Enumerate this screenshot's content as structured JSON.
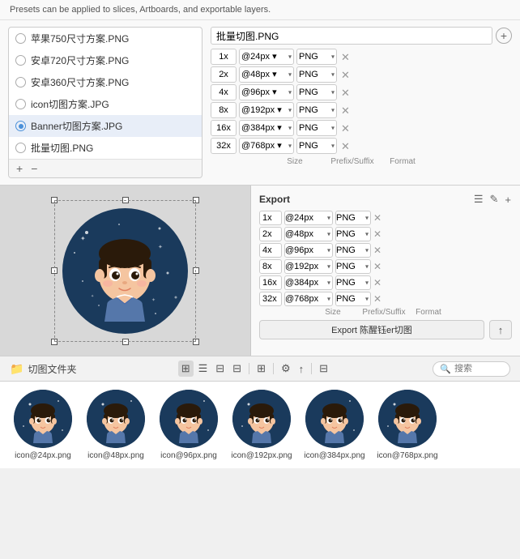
{
  "hint": "Presets can be applied to slices, Artboards, and exportable layers.",
  "presets": {
    "items": [
      {
        "label": "苹果750尺寸方案.PNG",
        "checked": false
      },
      {
        "label": "安卓720尺寸方案.PNG",
        "checked": false
      },
      {
        "label": "安卓360尺寸方案.PNG",
        "checked": false
      },
      {
        "label": "icon切图方案.JPG",
        "checked": false
      },
      {
        "label": "Banner切图方案.JPG",
        "checked": true
      },
      {
        "label": "批量切图.PNG",
        "checked": false
      }
    ],
    "add_btn": "+",
    "remove_btn": "−"
  },
  "export_preset": {
    "name": "批量切图.PNG",
    "rows": [
      {
        "scale": "1x",
        "size": "@24px",
        "format": "PNG"
      },
      {
        "scale": "2x",
        "size": "@48px",
        "format": "PNG"
      },
      {
        "scale": "4x",
        "size": "@96px",
        "format": "PNG"
      },
      {
        "scale": "8x",
        "size": "@192px",
        "format": "PNG"
      },
      {
        "scale": "16x",
        "size": "@384px",
        "format": "PNG"
      },
      {
        "scale": "32x",
        "size": "@768px",
        "format": "PNG"
      }
    ],
    "col_size": "Size",
    "col_prefix": "Prefix/Suffix",
    "col_format": "Format"
  },
  "export_right": {
    "title": "Export",
    "rows": [
      {
        "scale": "1x",
        "size": "@24px",
        "format": "PNG"
      },
      {
        "scale": "2x",
        "size": "@48px",
        "format": "PNG"
      },
      {
        "scale": "4x",
        "size": "@96px",
        "format": "PNG"
      },
      {
        "scale": "8x",
        "size": "@192px",
        "format": "PNG"
      },
      {
        "scale": "16x",
        "size": "@384px",
        "format": "PNG"
      },
      {
        "scale": "32x",
        "size": "@768px",
        "format": "PNG"
      }
    ],
    "col_size": "Size",
    "col_prefix": "Prefix/Suffix",
    "col_format": "Format",
    "export_btn": "Export 陈醒钰er切图",
    "share_icon": "↑"
  },
  "toolbar": {
    "folder_label": "切图文件夹",
    "search_placeholder": "搜索",
    "view_btns": [
      "⊞",
      "☰",
      "⊟",
      "⊟"
    ],
    "settings_icon": "⚙",
    "action_icon": "↑"
  },
  "files": [
    {
      "name": "icon@24px.png"
    },
    {
      "name": "icon@48px.png"
    },
    {
      "name": "icon@96px.png"
    },
    {
      "name": "icon@192px.png"
    },
    {
      "name": "icon@384px.png"
    },
    {
      "name": "icon@768px.png"
    }
  ]
}
